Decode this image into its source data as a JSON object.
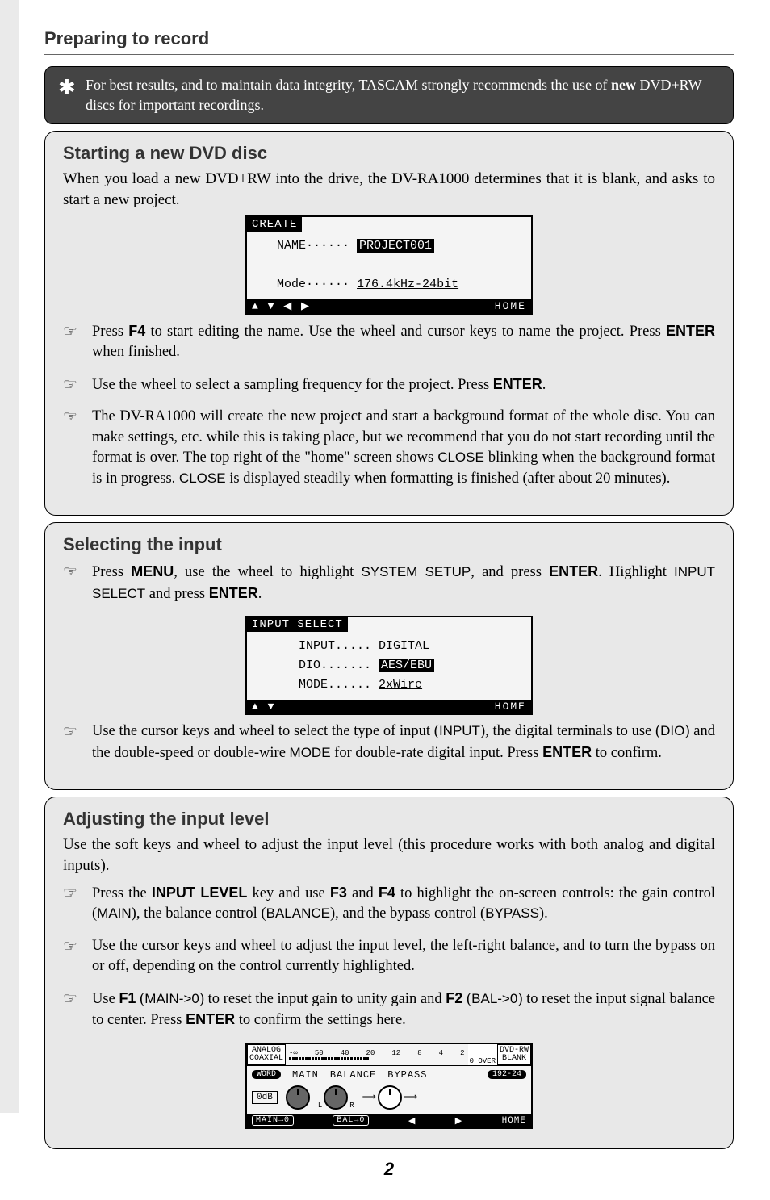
{
  "top_heading": "Preparing to record",
  "note": {
    "text_prefix": "For best results, and to maintain data integrity, TASCAM strongly recommends the use of ",
    "bold": "new",
    "text_suffix": " DVD+RW discs for important recordings."
  },
  "section1": {
    "heading": "Starting a new DVD disc",
    "lead": "When you load a new DVD+RW into the drive, the DV-RA1000 determines that it is blank, and asks to start a new project.",
    "lcd": {
      "title": "CREATE",
      "name_label": "NAME······",
      "name_value": "PROJECT001",
      "mode_label": "Mode······",
      "mode_value": "176.4kHz-24bit",
      "footer_arrows": "▲    ▼    ◀    ▶",
      "footer_home": "HOME"
    },
    "bullets": [
      {
        "parts": [
          {
            "t": "Press "
          },
          {
            "k": "F4"
          },
          {
            "t": " to start editing the name. Use the wheel and cursor keys to name the project.  Press "
          },
          {
            "k": "ENTER"
          },
          {
            "t": " when finished."
          }
        ]
      },
      {
        "parts": [
          {
            "t": "Use the wheel to select a sampling frequency for the project. Press "
          },
          {
            "k": "ENTER"
          },
          {
            "t": "."
          }
        ]
      },
      {
        "parts": [
          {
            "t": "The DV-RA1000 will create the new project and start a background format of the whole disc. You can make settings, etc. while this is taking place, but we recommend that you do not start recording until the format is over. The top right of the \"home\" screen shows "
          },
          {
            "s": "CLOSE"
          },
          {
            "t": " blinking when the background format is in progress. "
          },
          {
            "s": "CLOSE"
          },
          {
            "t": " is displayed steadily when formatting is finished (after about 20 minutes)."
          }
        ]
      }
    ]
  },
  "section2": {
    "heading": "Selecting the input",
    "bullets_top": [
      {
        "parts": [
          {
            "t": "Press "
          },
          {
            "k": "MENU"
          },
          {
            "t": ", use the wheel to highlight "
          },
          {
            "s": "SYSTEM SETUP"
          },
          {
            "t": ", and press "
          },
          {
            "k": "ENTER"
          },
          {
            "t": ".  Highlight "
          },
          {
            "s": "INPUT SELECT"
          },
          {
            "t": " and press "
          },
          {
            "k": "ENTER"
          },
          {
            "t": "."
          }
        ]
      }
    ],
    "lcd": {
      "title": "INPUT SELECT",
      "input_label": "INPUT.....",
      "input_value": "DIGITAL",
      "dio_label": "DIO.......",
      "dio_value": "AES/EBU",
      "mode_label": "MODE......",
      "mode_value": "2xWire",
      "footer_arrows": "▲    ▼",
      "footer_home": "HOME"
    },
    "bullets_bottom": [
      {
        "parts": [
          {
            "t": "Use the cursor keys and wheel to select the type of input ("
          },
          {
            "s": "INPUT"
          },
          {
            "t": "), the digital terminals to use ("
          },
          {
            "s": "DIO"
          },
          {
            "t": ") and the double-speed or double-wire "
          },
          {
            "s": "MODE"
          },
          {
            "t": " for double-rate digital input.  Press "
          },
          {
            "k": "ENTER"
          },
          {
            "t": " to confirm."
          }
        ]
      }
    ]
  },
  "section3": {
    "heading": "Adjusting the input level",
    "lead": "Use the soft keys and wheel to adjust the input level (this procedure works with both analog and digital inputs).",
    "bullets": [
      {
        "parts": [
          {
            "t": "Press the "
          },
          {
            "k": "INPUT LEVEL"
          },
          {
            "t": " key and use "
          },
          {
            "k": "F3"
          },
          {
            "t": " and "
          },
          {
            "k": "F4"
          },
          {
            "t": " to highlight the on-screen controls: the gain control ("
          },
          {
            "s": "MAIN"
          },
          {
            "t": "), the balance control ("
          },
          {
            "s": "BALANCE"
          },
          {
            "t": "), and the bypass control ("
          },
          {
            "s": "BYPASS"
          },
          {
            "t": ")."
          }
        ]
      },
      {
        "parts": [
          {
            "t": "Use the cursor keys and wheel to adjust the input level, the left-right balance, and to turn the bypass on or off, depending on the control currently highlighted."
          }
        ]
      },
      {
        "parts": [
          {
            "t": "Use "
          },
          {
            "k": "F1"
          },
          {
            "t": " ("
          },
          {
            "s": "MAIN->0"
          },
          {
            "t": ") to reset the input gain to unity gain and "
          },
          {
            "k": "F2"
          },
          {
            "t": " ("
          },
          {
            "s": "BAL->0"
          },
          {
            "t": ") to reset the input signal balance to center. Press "
          },
          {
            "k": "ENTER"
          },
          {
            "t": " to confirm the settings here."
          }
        ]
      }
    ],
    "lcd_home": {
      "left_tag_top": "ANALOG",
      "left_tag_bot": "COAXIAL",
      "meter_ticks": [
        "-∞",
        "50",
        "40",
        "20",
        "12",
        "8",
        "4",
        "2"
      ],
      "over_tag": "0 OVER",
      "right_tag_top": "DVD-RW",
      "right_tag_bot": "BLANK",
      "word": "WORD",
      "rate_tag": "192-24",
      "main": "MAIN",
      "balance": "BALANCE",
      "bypass": "BYPASS",
      "db_label": "0dB",
      "f1": "MAIN→0",
      "f2": "BAL→0",
      "home": "HOME"
    }
  },
  "page_num": "2"
}
